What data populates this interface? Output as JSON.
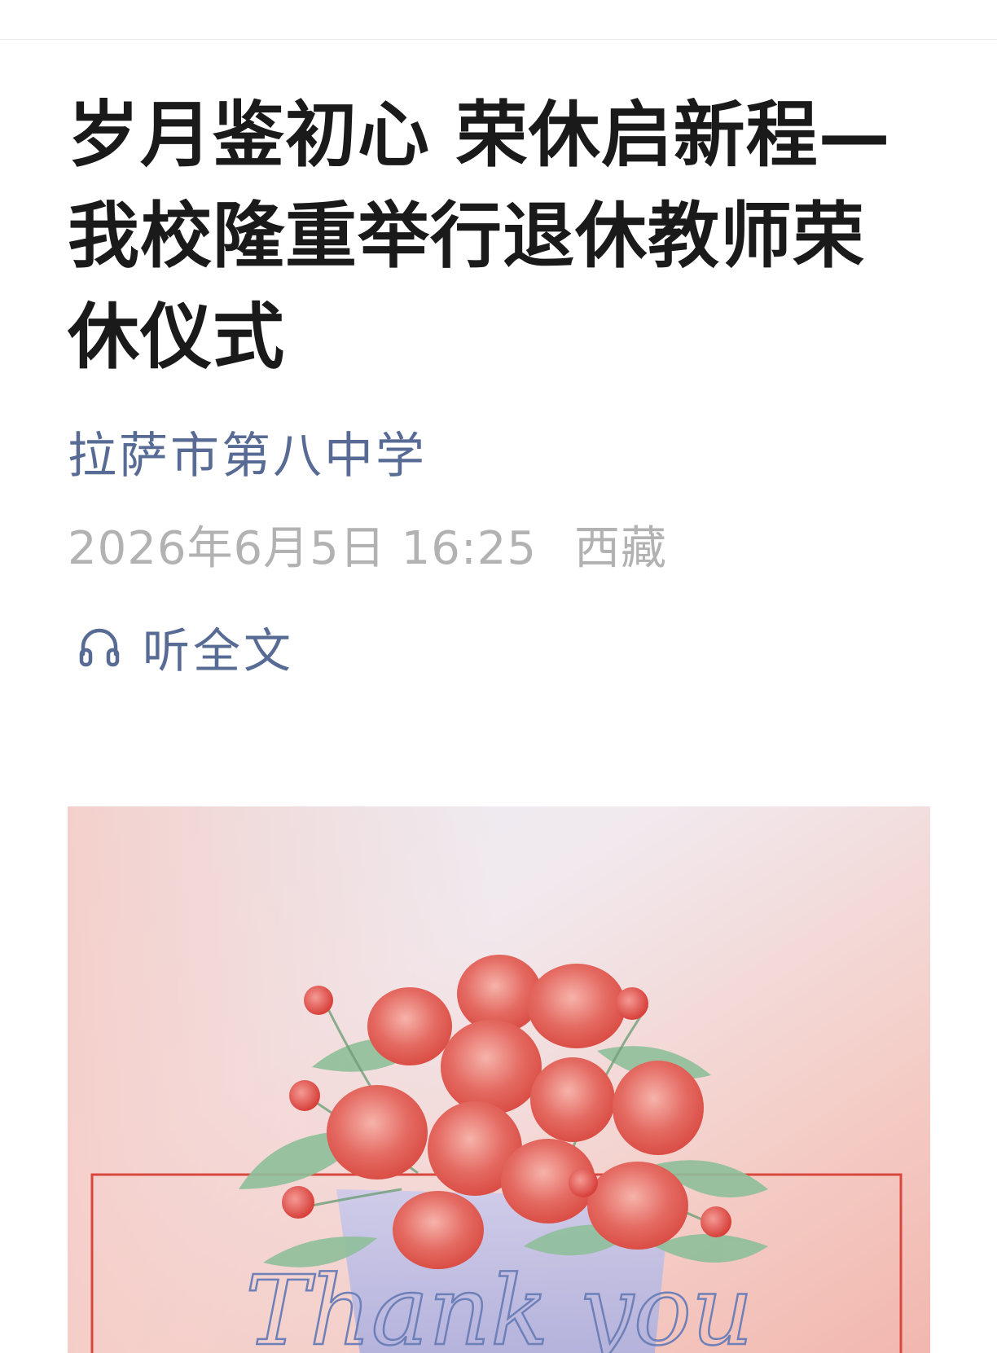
{
  "article": {
    "title": "岁月鉴初心 荣休启新程—我校隆重举行退休教师荣休仪式",
    "author": "拉萨市第八中学",
    "date": "2026年6月5日 16:25",
    "location": "西藏",
    "listen_label": "听全文"
  },
  "hero_image": {
    "script_text": "Thank you",
    "icon_names": [
      "headphones-icon"
    ]
  },
  "colors": {
    "link_blue": "#576b95",
    "meta_gray": "#b2b2b2",
    "title_black": "#1a1a1a",
    "rose_red": "#e0514f",
    "leaf_green": "#8fbf9a",
    "frame_red": "#d8483f"
  }
}
